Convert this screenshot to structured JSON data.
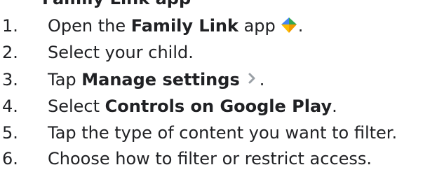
{
  "cropped_top_text": "Family Link app",
  "steps": [
    {
      "number": "1.",
      "pre": "Open the ",
      "bold": "Family Link",
      "post": " app",
      "icon": "family-link-app-icon",
      "trail": "."
    },
    {
      "number": "2.",
      "pre": "Select your child."
    },
    {
      "number": "3.",
      "pre": "Tap ",
      "bold": "Manage settings",
      "icon": "chevron-right-icon",
      "trail": "."
    },
    {
      "number": "4.",
      "pre": "Select ",
      "bold": "Controls on Google Play",
      "trail": "."
    },
    {
      "number": "5.",
      "pre": "Tap the type of content you want to filter."
    },
    {
      "number": "6.",
      "pre": "Choose how to filter or restrict access."
    }
  ],
  "colors": {
    "text": "#202124",
    "icon_blue": "#4285f4",
    "icon_green": "#34a853",
    "icon_yellow": "#fbbc04",
    "chevron": "#9aa0a6"
  }
}
